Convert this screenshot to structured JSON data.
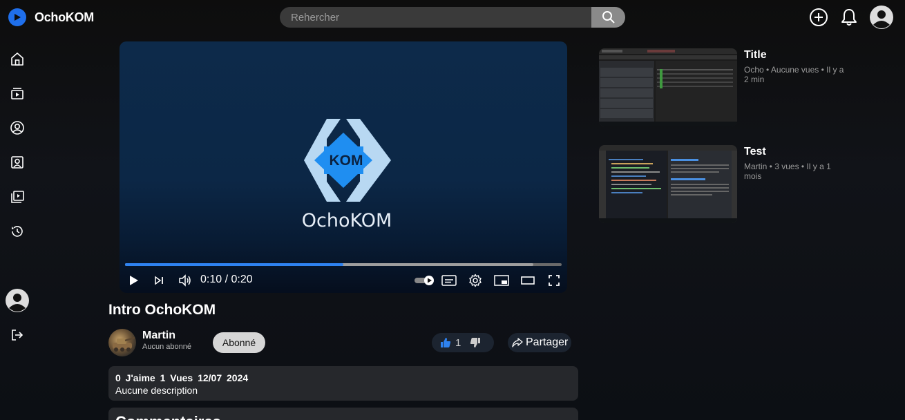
{
  "app": {
    "name": "OchoKOM"
  },
  "search": {
    "placeholder": "Rehercher"
  },
  "header": {
    "icons": [
      "add-icon",
      "bell-icon",
      "user-avatar-icon"
    ]
  },
  "sidebar": {
    "icons": [
      "home-icon",
      "subscriptions-icon",
      "account-icon",
      "channel-icon",
      "playlist-icon",
      "history-icon",
      "profile-avatar-icon",
      "logout-icon"
    ]
  },
  "player": {
    "logo_text": "OchoKOM",
    "badge_text": "KOM",
    "time": "0:10 / 0:20",
    "progress_fraction": 0.5,
    "buffered_fraction": 0.935,
    "accent": "#2e82f0"
  },
  "video": {
    "title": "Intro OchoKOM",
    "channel": "Martin",
    "subscribers": "Aucun abonné",
    "subscribe_label": "Abonné",
    "likes": "1",
    "share_label": "Partager",
    "stats": "0 J'aime 1 Vues 12/07 2024",
    "description": "Aucune description",
    "comments_title": "Commentaires"
  },
  "recommendations": [
    {
      "title": "Title",
      "meta": "Ocho • Aucune vues • Il y a 2 min"
    },
    {
      "title": "Test",
      "meta": "Martin • 3 vues • Il y a 1 mois"
    }
  ],
  "colors": {
    "brand": "#1f6feb",
    "background": "#0d0d0d"
  }
}
